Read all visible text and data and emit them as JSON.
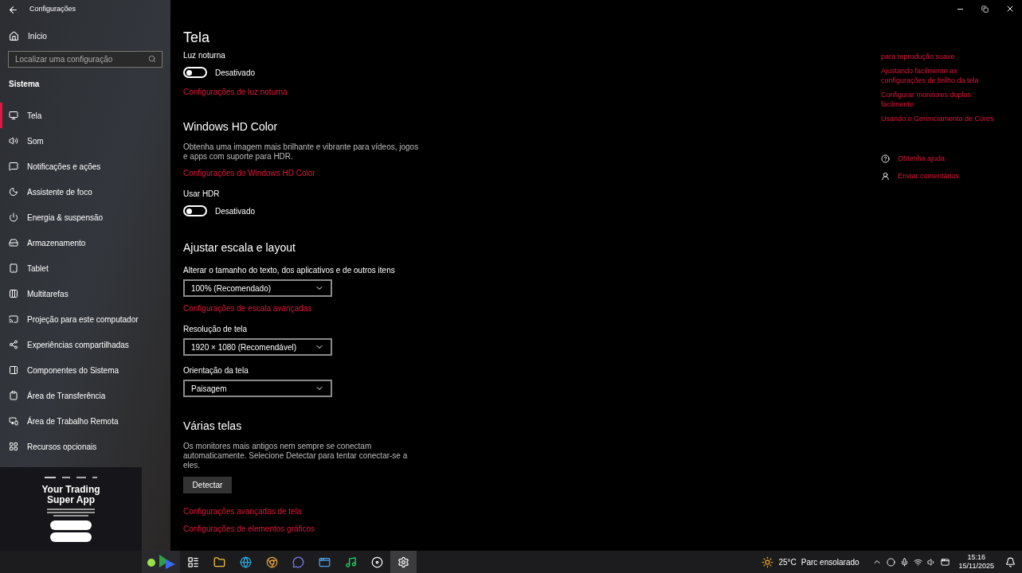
{
  "window": {
    "title": "Configurações"
  },
  "sidebar": {
    "home": "Início",
    "search": {
      "placeholder": "Localizar uma configuração"
    },
    "section": "Sistema",
    "items": [
      {
        "label": "Tela",
        "selected": true
      },
      {
        "label": "Som",
        "selected": false
      },
      {
        "label": "Notificações e ações",
        "selected": false
      },
      {
        "label": "Assistente de foco",
        "selected": false
      },
      {
        "label": "Energia & suspensão",
        "selected": false
      },
      {
        "label": "Armazenamento",
        "selected": false
      },
      {
        "label": "Tablet",
        "selected": false
      },
      {
        "label": "Multitarefas",
        "selected": false
      },
      {
        "label": "Projeção para este computador",
        "selected": false
      },
      {
        "label": "Experiências compartilhadas",
        "selected": false
      },
      {
        "label": "Componentes do Sistema",
        "selected": false
      },
      {
        "label": "Área de Transferência",
        "selected": false
      },
      {
        "label": "Área de Trabalho Remota",
        "selected": false
      },
      {
        "label": "Recursos opcionais",
        "selected": false
      }
    ]
  },
  "preview": {
    "headline": "Your Trading Super App"
  },
  "page": {
    "title": "Tela",
    "blocks": [
      {
        "kind": "label",
        "text": "Luz noturna"
      },
      {
        "kind": "toggle",
        "on": false,
        "text": "Desativado"
      },
      {
        "kind": "link",
        "text": "Configurações de luz noturna"
      },
      {
        "kind": "heading",
        "text": "Windows HD Color"
      },
      {
        "kind": "text",
        "text": "Obtenha uma imagem mais brilhante e vibrante para vídeos, jogos e apps com suporte para HDR."
      },
      {
        "kind": "link",
        "text": "Configurações do Windows HD Color"
      },
      {
        "kind": "label",
        "text": "Usar HDR"
      },
      {
        "kind": "toggle",
        "on": false,
        "text": "Desativado"
      },
      {
        "kind": "heading",
        "text": "Ajustar escala e layout"
      },
      {
        "kind": "label",
        "text": "Alterar o tamanho do texto, dos aplicativos e de outros itens"
      },
      {
        "kind": "dropdown",
        "text": "100% (Recomendado)"
      },
      {
        "kind": "link",
        "text": "Configurações de escala avançadas"
      },
      {
        "kind": "label",
        "text": "Resolução de tela"
      },
      {
        "kind": "dropdown",
        "text": "1920 × 1080 (Recomendável)"
      },
      {
        "kind": "label",
        "text": "Orientação da tela"
      },
      {
        "kind": "dropdown",
        "text": "Paisagem"
      },
      {
        "kind": "heading",
        "text": "Várias telas"
      },
      {
        "kind": "text",
        "text": "Os monitores mais antigos nem sempre se conectam automaticamente. Selecione Detectar para tentar conectar-se a eles."
      },
      {
        "kind": "button",
        "text": "Detectar"
      },
      {
        "kind": "link",
        "text": "Configurações avançadas de tela"
      },
      {
        "kind": "link",
        "text": "Configurações de elementos gráficos"
      }
    ]
  },
  "related": {
    "links": [
      "para reprodução suave",
      "Ajustando facilmente as configurações de brilho da tela",
      "Configurar monitores duplos facilmente",
      "Usando o Gerenciamento de Cores"
    ],
    "help": [
      "Obtenha ajuda",
      "Enviar comentários"
    ]
  },
  "taskbar": {
    "apps": [
      {
        "selected": false
      },
      {
        "selected": false
      },
      {
        "selected": false
      },
      {
        "selected": false
      },
      {
        "selected": false
      },
      {
        "selected": false
      },
      {
        "selected": false
      },
      {
        "selected": false
      },
      {
        "selected": true
      }
    ],
    "weather": {
      "temp": "25°C",
      "text": "Parc ensolarado"
    },
    "time": "15:16",
    "date": "15/11/2025"
  }
}
